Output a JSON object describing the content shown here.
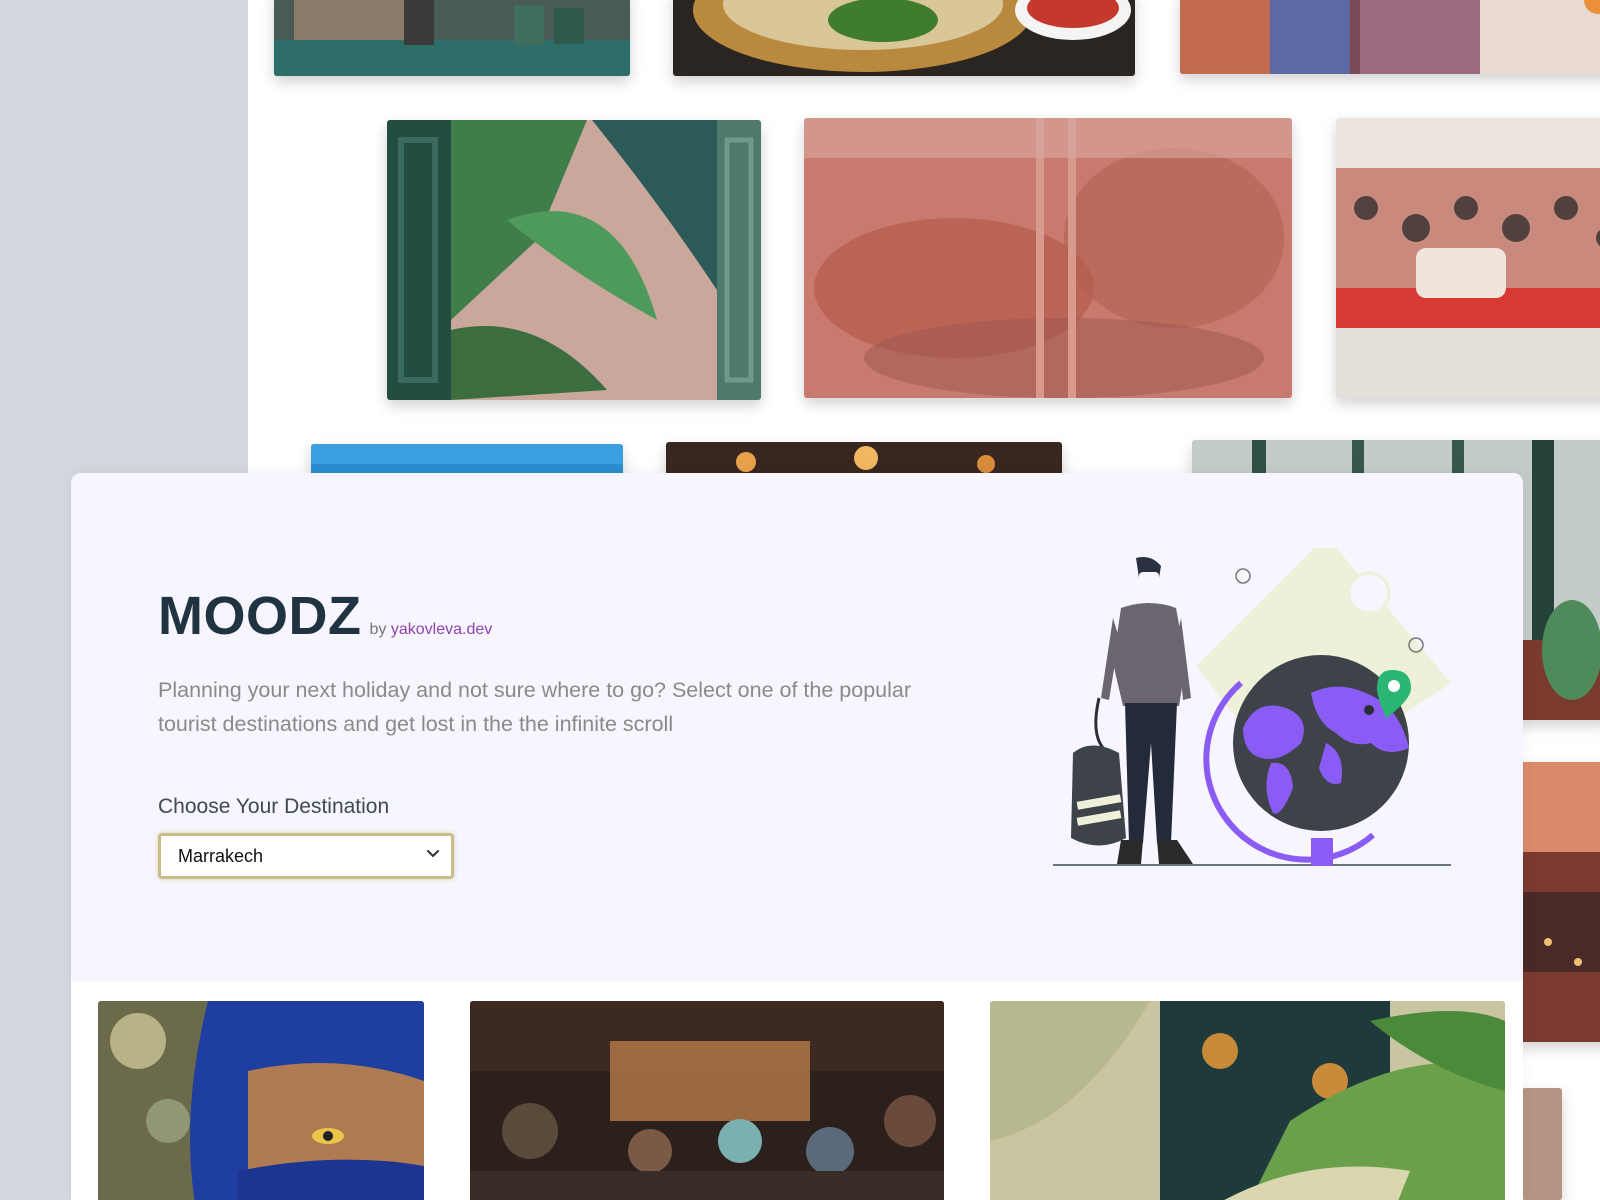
{
  "app": {
    "title": "MOODZ",
    "by_prefix": "by",
    "by_link": "yakovleva.dev",
    "description": "Planning your next holiday and not sure where to go? Select one of the popular tourist destinations and get lost in the the infinite scroll",
    "destination_label": "Choose Your Destination",
    "selected_destination": "Marrakech"
  },
  "colors": {
    "accent": "#8e44ad",
    "title": "#1f3340",
    "hero_background": "#f7f5fd",
    "select_border": "#c9be8a",
    "globe_purple": "#8a5cf5",
    "pin_green": "#2bb673"
  },
  "icons": {
    "select_arrow": "chevron-down-icon",
    "illustration": "traveler-globe-illustration"
  }
}
